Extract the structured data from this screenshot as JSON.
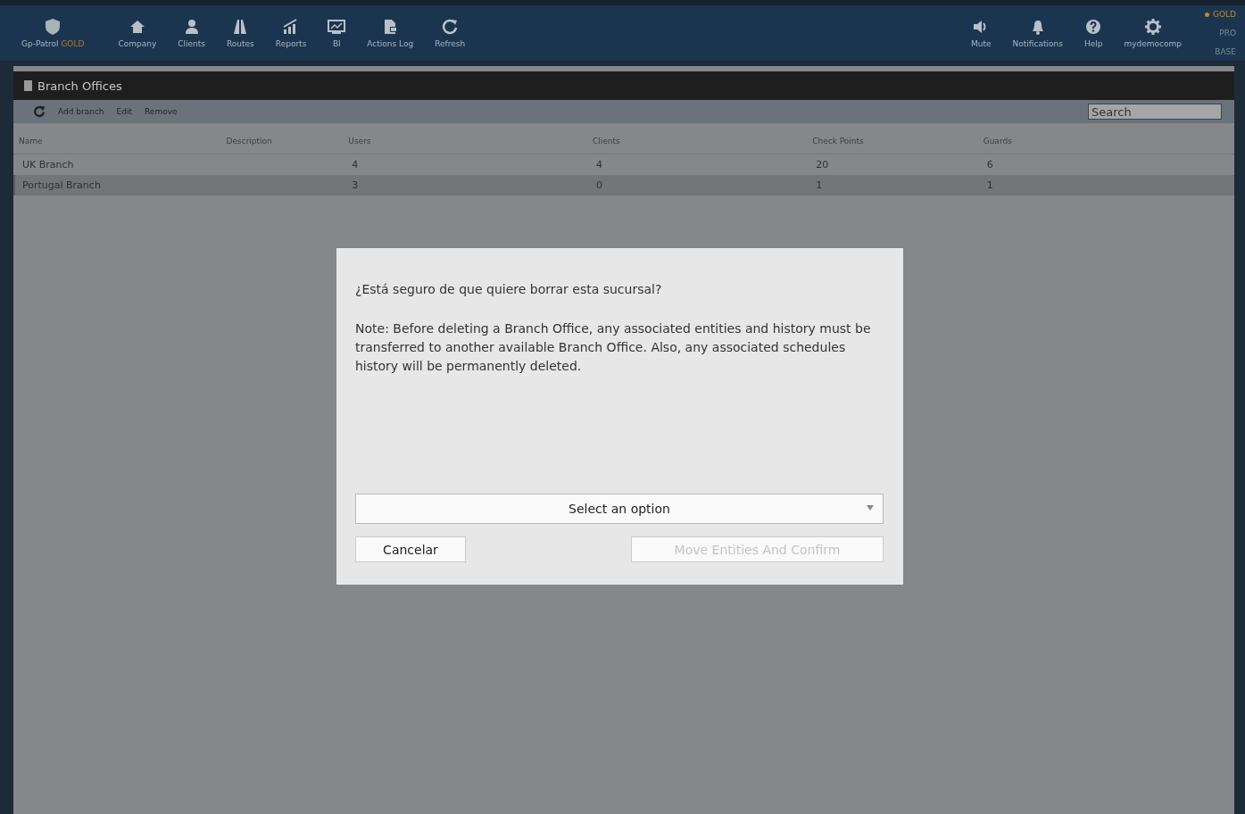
{
  "navbar": {
    "brand": {
      "label": "Gp-Patrol",
      "tier": "GOLD"
    },
    "items": [
      {
        "kind": "home",
        "label": "Company"
      },
      {
        "kind": "user",
        "label": "Clients"
      },
      {
        "kind": "road",
        "label": "Routes"
      },
      {
        "kind": "chart",
        "label": "Reports"
      },
      {
        "kind": "screen",
        "label": "BI"
      },
      {
        "kind": "doc",
        "label": "Actions Log"
      },
      {
        "kind": "refresh",
        "label": "Refresh"
      }
    ],
    "right_items": [
      {
        "kind": "speaker",
        "label": "Mute"
      },
      {
        "kind": "bell",
        "label": "Notifications"
      },
      {
        "kind": "help",
        "label": "Help"
      },
      {
        "kind": "gear",
        "label": "mydemocomp"
      }
    ],
    "plans": [
      {
        "label": "GOLD",
        "selected": true
      },
      {
        "label": "PRO",
        "selected": false
      },
      {
        "label": "BASE",
        "selected": false
      }
    ]
  },
  "panel": {
    "title": "Branch Offices",
    "toolbar": [
      "Add branch",
      "Edit",
      "Remove"
    ],
    "search": {
      "placeholder": "Search"
    }
  },
  "table": {
    "columns": [
      "Name",
      "Description",
      "Users",
      "Clients",
      "Check Points",
      "Guards"
    ],
    "rows": [
      {
        "cells": [
          "UK Branch",
          "",
          "4",
          "4",
          "20",
          "6"
        ],
        "selected": false
      },
      {
        "cells": [
          "Portugal Branch",
          "",
          "3",
          "0",
          "1",
          "1"
        ],
        "selected": true
      }
    ]
  },
  "dialog": {
    "question": "¿Está seguro de que quiere borrar esta sucursal?",
    "note": "Note: Before deleting a Branch Office, any associated entities and history must be transferred to another available Branch Office. Also, any associated schedules history will be permanently deleted.",
    "select": {
      "placeholder": "Select an option"
    },
    "cancel": "Cancelar",
    "confirm": {
      "label": "Move Entities And Confirm",
      "disabled": true
    }
  }
}
